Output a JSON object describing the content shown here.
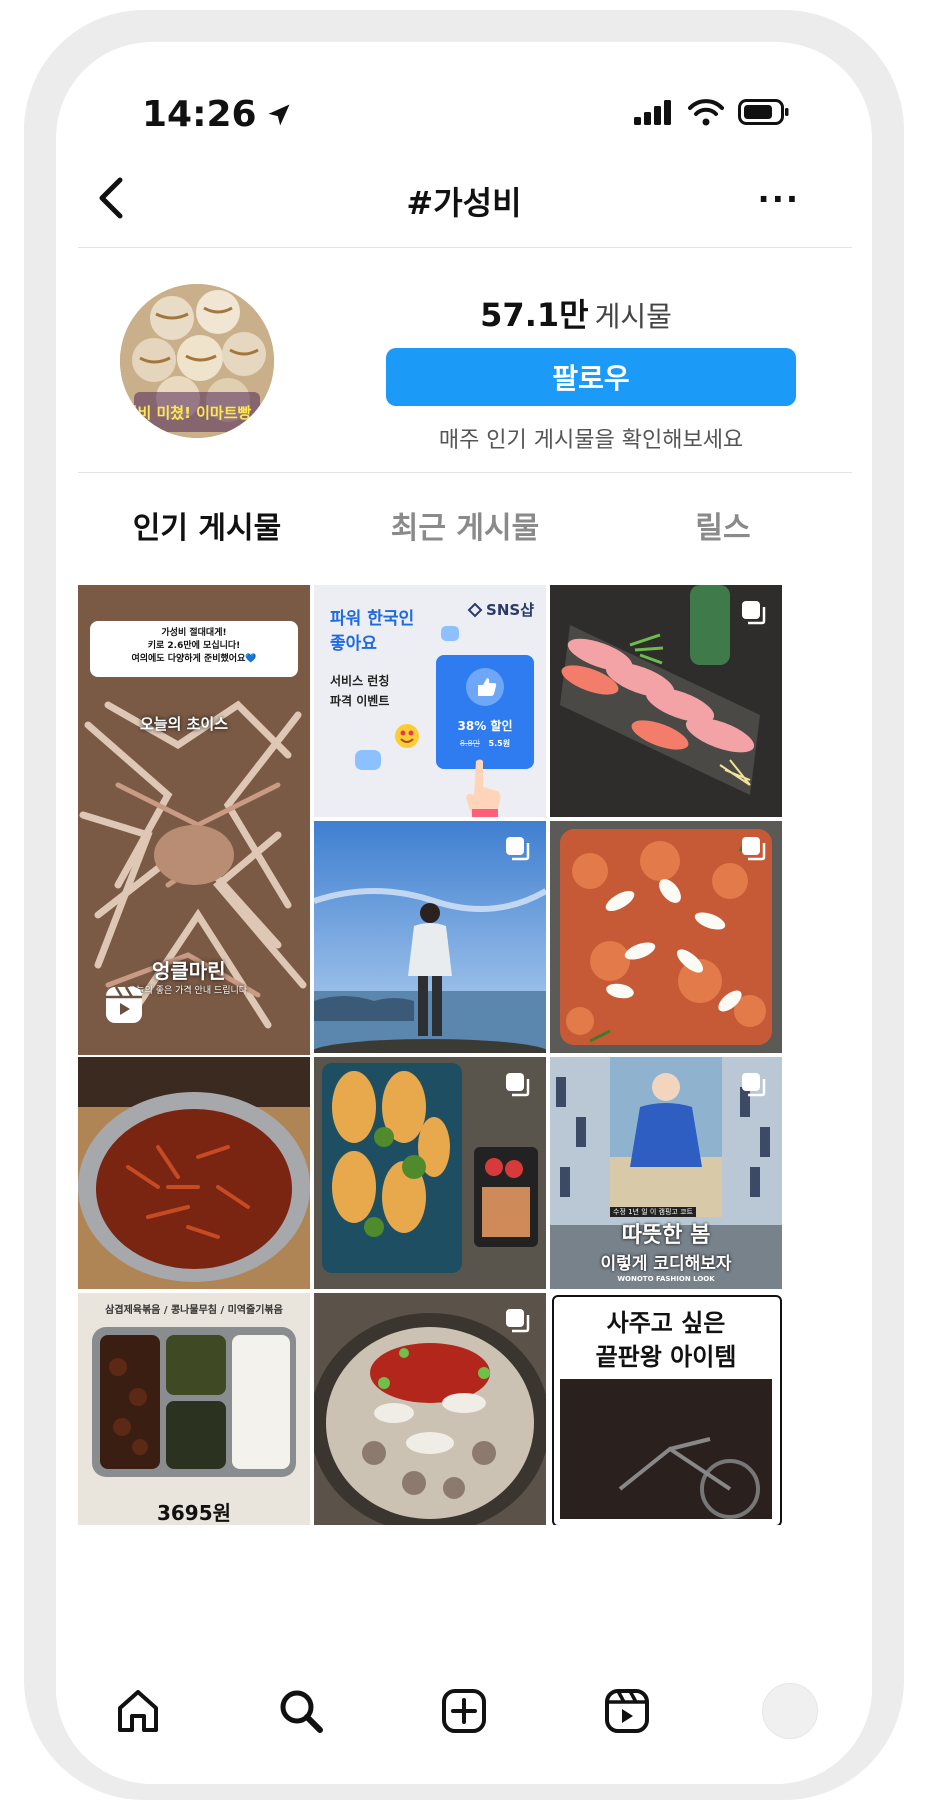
{
  "status_bar": {
    "time": "14:26"
  },
  "header": {
    "title": "#가성비",
    "more_label": "···"
  },
  "profile": {
    "post_count": "57.1만",
    "post_count_label": "게시물",
    "follow_label": "팔로우",
    "subtitle": "매주 인기 게시물을 확인해보세요",
    "avatar_caption": "가성비 미쳤! 이마트빵 추천"
  },
  "tabs": [
    {
      "label": "인기 게시물",
      "active": true
    },
    {
      "label": "최근 게시물",
      "active": false
    },
    {
      "label": "릴스",
      "active": false
    }
  ],
  "posts": {
    "crab": {
      "bubble_line1": "가성비 절대대게!",
      "bubble_line2": "키로 2.6만에 모십니다!",
      "bubble_line3": "여의에도 다양하게 준비했어요💙",
      "sticker": "오늘의 초이스",
      "caption": "엉클마린",
      "subcaption": "오늘의 좋은 가격 안내 드립니다"
    },
    "sns": {
      "brand": "SNS샵",
      "headline1": "파워 한국인",
      "headline2": "좋아요",
      "sub1": "서비스 런칭",
      "sub2": "파격 이벤트",
      "discount": "38% 할인",
      "old_price": "8.8만",
      "new_price": "5.5원"
    },
    "fashion": {
      "small": "수정 1년 일 이 캠핑고 코트",
      "line1": "따뜻한 봄",
      "line2": "이렇게 코디해보자",
      "brand": "WONOTO FASHION LOOK"
    },
    "lunch": {
      "header": "삼겹제육볶음 / 콩나물무침 / 미역줄기볶음",
      "price": "3695원"
    },
    "bike": {
      "line1": "사주고 싶은",
      "line2": "끝판왕 아이템"
    }
  },
  "colors": {
    "accent": "#1b9af7",
    "inactive_tab": "#8a8a8a"
  },
  "nav": [
    "home-icon",
    "search-icon",
    "create-icon",
    "reels-icon",
    "profile-avatar"
  ]
}
